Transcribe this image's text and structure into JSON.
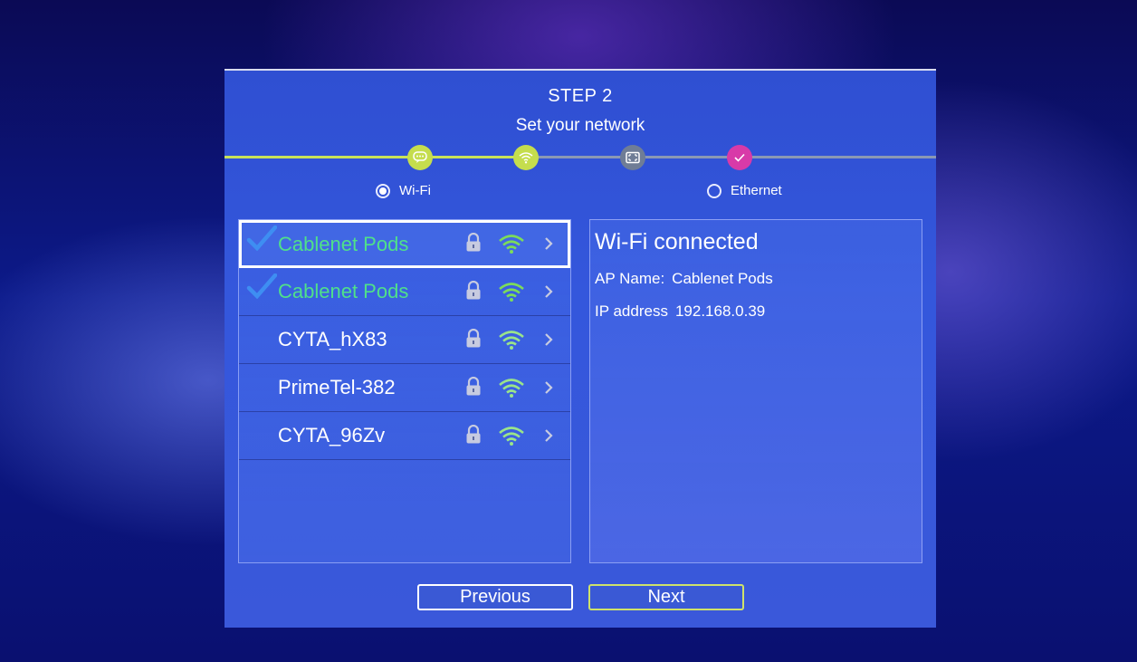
{
  "header": {
    "step": "STEP 2",
    "subtitle": "Set your network"
  },
  "progress": {
    "nodes": [
      {
        "icon": "chat-icon",
        "state": "done"
      },
      {
        "icon": "wifi-icon",
        "state": "current"
      },
      {
        "icon": "screen-icon",
        "state": "pending"
      },
      {
        "icon": "check-icon",
        "state": "pending"
      }
    ],
    "completed_fraction": 0.42
  },
  "connection_type": {
    "wifi_label": "Wi-Fi",
    "ethernet_label": "Ethernet",
    "selected": "Wi-Fi"
  },
  "networks": [
    {
      "name": "Cablenet Pods",
      "connected": true,
      "locked": true,
      "focused": true
    },
    {
      "name": "Cablenet Pods",
      "connected": true,
      "locked": true,
      "focused": false
    },
    {
      "name": "CYTA_hX83",
      "connected": false,
      "locked": true,
      "focused": false
    },
    {
      "name": "PrimeTel-382",
      "connected": false,
      "locked": true,
      "focused": false
    },
    {
      "name": "CYTA_96Zv",
      "connected": false,
      "locked": true,
      "focused": false
    }
  ],
  "status": {
    "title": "Wi-Fi connected",
    "ap_label": "AP Name:",
    "ap_value": "Cablenet Pods",
    "ip_label": "IP address",
    "ip_value": "192.168.0.39"
  },
  "buttons": {
    "previous": "Previous",
    "next": "Next"
  },
  "colors": {
    "accent_green": "#c5dd4d",
    "connected_text": "#4fe08a",
    "pending_node": "#6f7d96",
    "final_node": "#d83aa8",
    "panel": "#3457dc"
  }
}
